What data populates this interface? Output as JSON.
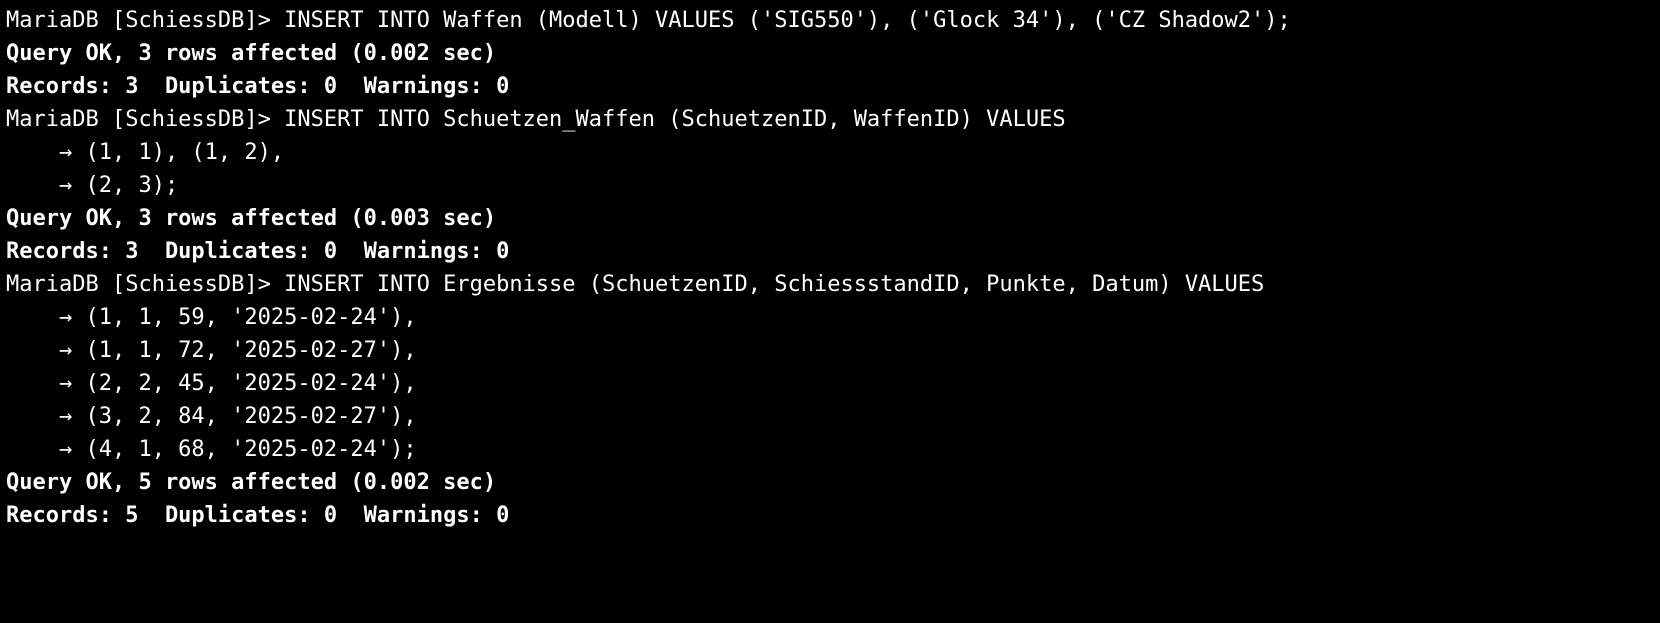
{
  "prompt": "MariaDB [SchiessDB]> ",
  "cont": "    → ",
  "blocks": [
    {
      "cmd_lines": [
        "INSERT INTO Waffen (Modell) VALUES ('SIG550'), ('Glock 34'), ('CZ Shadow2');"
      ],
      "result_lines": [
        "Query OK, 3 rows affected (0.002 sec)",
        "Records: 3  Duplicates: 0  Warnings: 0"
      ]
    },
    {
      "cmd_lines": [
        "INSERT INTO Schuetzen_Waffen (SchuetzenID, WaffenID) VALUES",
        "(1, 1), (1, 2),",
        "(2, 3);"
      ],
      "result_lines": [
        "Query OK, 3 rows affected (0.003 sec)",
        "Records: 3  Duplicates: 0  Warnings: 0"
      ]
    },
    {
      "cmd_lines": [
        "INSERT INTO Ergebnisse (SchuetzenID, SchiessstandID, Punkte, Datum) VALUES",
        "(1, 1, 59, '2025-02-24'),",
        "(1, 1, 72, '2025-02-27'),",
        "(2, 2, 45, '2025-02-24'),",
        "(3, 2, 84, '2025-02-27'),",
        "(4, 1, 68, '2025-02-24');"
      ],
      "result_lines": [
        "Query OK, 5 rows affected (0.002 sec)",
        "Records: 5  Duplicates: 0  Warnings: 0"
      ]
    }
  ]
}
